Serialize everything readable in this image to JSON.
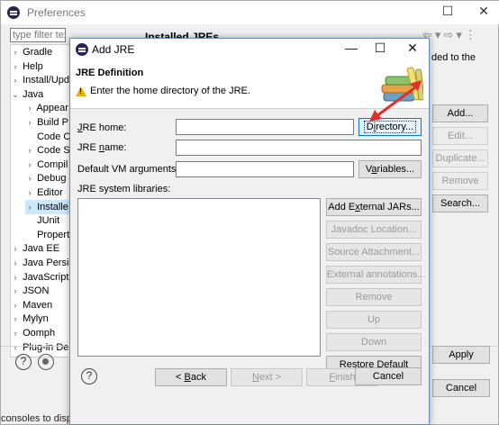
{
  "preferences": {
    "window_title": "Preferences",
    "filter_placeholder": "type filter text",
    "tree": [
      {
        "label": "Gradle",
        "twisty": "›",
        "indent": 0
      },
      {
        "label": "Help",
        "twisty": "›",
        "indent": 0
      },
      {
        "label": "Install/Upd",
        "twisty": "›",
        "indent": 0
      },
      {
        "label": "Java",
        "twisty": "⌄",
        "indent": 0
      },
      {
        "label": "Appear",
        "twisty": "›",
        "indent": 1
      },
      {
        "label": "Build P",
        "twisty": "›",
        "indent": 1
      },
      {
        "label": "Code C",
        "twisty": "",
        "indent": 1
      },
      {
        "label": "Code S",
        "twisty": "›",
        "indent": 1
      },
      {
        "label": "Compil",
        "twisty": "›",
        "indent": 1
      },
      {
        "label": "Debug",
        "twisty": "›",
        "indent": 1
      },
      {
        "label": "Editor",
        "twisty": "›",
        "indent": 1
      },
      {
        "label": "Installe",
        "twisty": "›",
        "indent": 1
      },
      {
        "label": "JUnit",
        "twisty": "",
        "indent": 1
      },
      {
        "label": "Propert",
        "twisty": "",
        "indent": 1
      },
      {
        "label": "Java EE",
        "twisty": "›",
        "indent": 0
      },
      {
        "label": "Java Persis",
        "twisty": "›",
        "indent": 0
      },
      {
        "label": "JavaScript",
        "twisty": "›",
        "indent": 0
      },
      {
        "label": "JSON",
        "twisty": "›",
        "indent": 0
      },
      {
        "label": "Maven",
        "twisty": "›",
        "indent": 0
      },
      {
        "label": "Mylyn",
        "twisty": "›",
        "indent": 0
      },
      {
        "label": "Oomph",
        "twisty": "›",
        "indent": 0
      },
      {
        "label": "Plug-in De",
        "twisty": "›",
        "indent": 0
      }
    ],
    "page_title": "Installed JREs",
    "desc_line1": "ded to the",
    "side_buttons": {
      "add": "Add...",
      "edit": "Edit...",
      "duplicate": "Duplicate...",
      "remove": "Remove",
      "search": "Search..."
    },
    "apply_label": "Apply",
    "cancel_label": "Cancel",
    "status_text": "consoles to display in the timer"
  },
  "dialog": {
    "window_title": "Add JRE",
    "header_title": "JRE Definition",
    "header_message": "Enter the home directory of the JRE.",
    "jre_home_label": "JRE home:",
    "jre_home_value": "",
    "directory_button": "Directory...",
    "jre_name_label": "JRE name:",
    "jre_name_value": "",
    "vm_args_label": "Default VM arguments:",
    "vm_args_value": "",
    "variables_button": "Variables...",
    "libraries_label": "JRE system libraries:",
    "lib_buttons": {
      "add_external": "Add External JARs...",
      "javadoc": "Javadoc Location...",
      "source": "Source Attachment...",
      "external_ann": "External annotations...",
      "remove": "Remove",
      "up": "Up",
      "down": "Down",
      "restore": "Restore Default"
    },
    "back_button": "< Back",
    "next_button": "Next >",
    "finish_button": "Finish",
    "cancel_button": "Cancel"
  },
  "colors": {
    "annotation_arrow": "#e0302a",
    "selection": "#cce8ff",
    "focus_border": "#0078d7"
  }
}
